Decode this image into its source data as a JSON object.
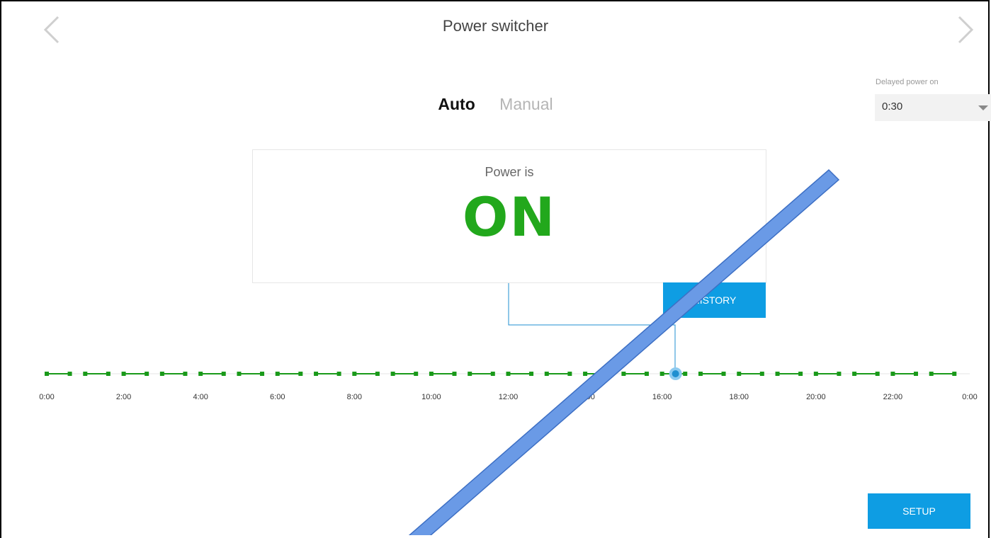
{
  "header": {
    "title": "Power switcher",
    "prev_icon": "chevron-left-icon",
    "next_icon": "chevron-right-icon"
  },
  "mode_tabs": {
    "auto": "Auto",
    "manual": "Manual",
    "selected": "auto"
  },
  "delayed_power": {
    "label": "Delayed power on",
    "value": "0:30"
  },
  "status": {
    "label": "Power is",
    "value": "ON",
    "color": "#22a81c"
  },
  "buttons": {
    "history": "HISTORY",
    "setup": "SETUP"
  },
  "timeline": {
    "tick_labels": [
      "0:00",
      "2:00",
      "4:00",
      "6:00",
      "8:00",
      "10:00",
      "12:00",
      "14:00",
      "16:00",
      "18:00",
      "20:00",
      "22:00",
      "0:00"
    ],
    "slot_count": 24,
    "schedule_color": "#1a9a1a",
    "current_time_hours": 16.35
  },
  "colors": {
    "accent": "#0e9de3",
    "on": "#22a81c",
    "annotation": "#5b8fdf"
  }
}
